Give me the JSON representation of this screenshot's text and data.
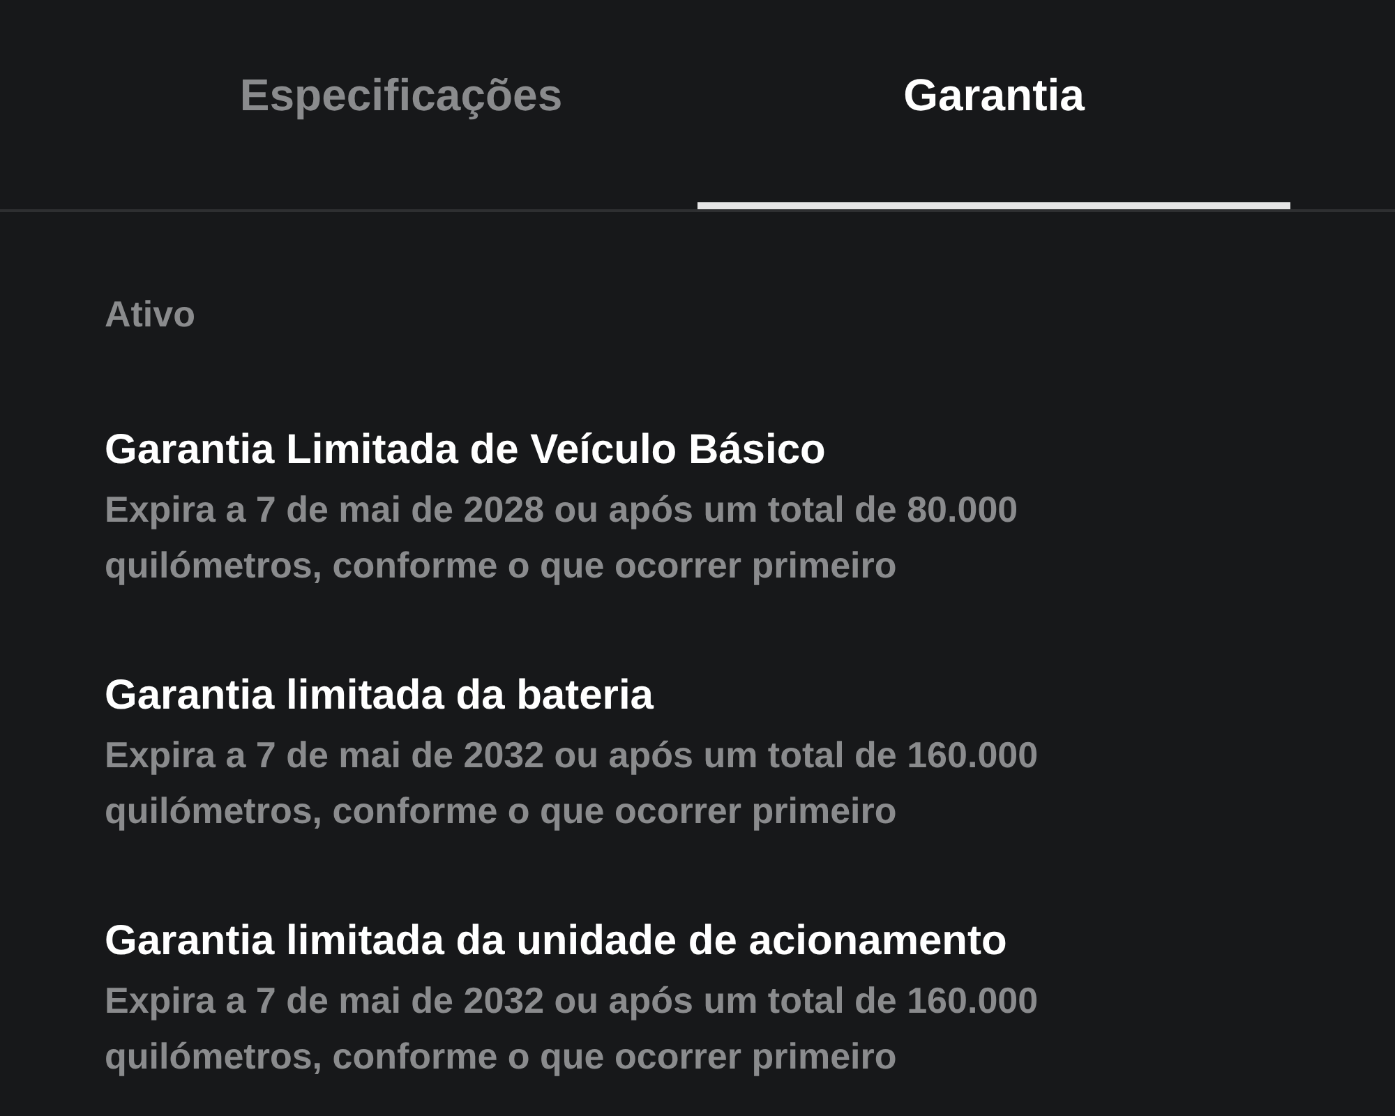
{
  "tabs": [
    {
      "label": "Especificações",
      "selected": false
    },
    {
      "label": "Garantia",
      "selected": true
    }
  ],
  "section": {
    "title": "Ativo"
  },
  "warranties": [
    {
      "title": "Garantia Limitada de Veículo Básico",
      "description": "Expira a 7 de mai de 2028 ou após um total de 80.000 quilómetros, conforme o que ocorrer primeiro"
    },
    {
      "title": "Garantia limitada da bateria",
      "description": "Expira a 7 de mai de 2032 ou após um total de 160.000 quilómetros, conforme o que ocorrer primeiro"
    },
    {
      "title": "Garantia limitada da unidade de acionamento",
      "description": "Expira a 7 de mai de 2032 ou após um total de 160.000 quilómetros, conforme o que ocorrer primeiro"
    }
  ]
}
